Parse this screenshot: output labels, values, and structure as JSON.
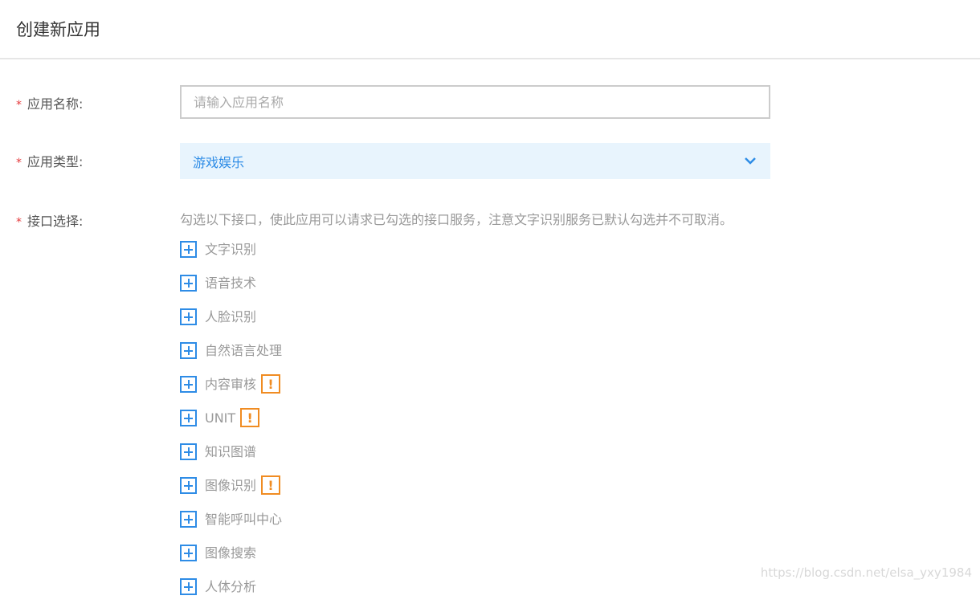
{
  "title": "创建新应用",
  "form": {
    "name_label": "应用名称:",
    "name_placeholder": "请输入应用名称",
    "type_label": "应用类型:",
    "type_value": "游戏娱乐",
    "api_label": "接口选择:",
    "api_hint": "勾选以下接口，使此应用可以请求已勾选的接口服务，注意文字识别服务已默认勾选并不可取消。",
    "required_mark": "*"
  },
  "apis": [
    {
      "label": "文字识别",
      "warn": false
    },
    {
      "label": "语音技术",
      "warn": false
    },
    {
      "label": "人脸识别",
      "warn": false
    },
    {
      "label": "自然语言处理",
      "warn": false
    },
    {
      "label": "内容审核",
      "warn": true
    },
    {
      "label": "UNIT",
      "warn": true
    },
    {
      "label": "知识图谱",
      "warn": false
    },
    {
      "label": "图像识别",
      "warn": true
    },
    {
      "label": "智能呼叫中心",
      "warn": false
    },
    {
      "label": "图像搜索",
      "warn": false
    },
    {
      "label": "人体分析",
      "warn": false
    }
  ],
  "warn_symbol": "!",
  "watermark": "https://blog.csdn.net/elsa_yxy1984",
  "colors": {
    "accent": "#2e8ce6",
    "warn": "#f08c22",
    "required": "#e4393c"
  }
}
